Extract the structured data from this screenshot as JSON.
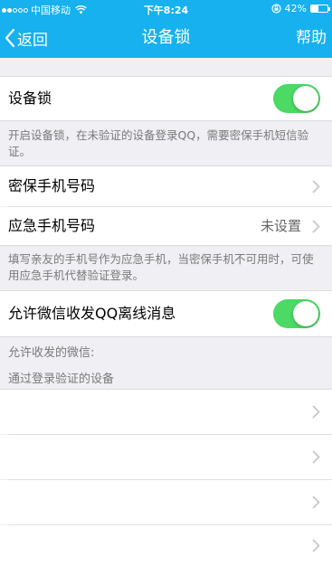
{
  "status_bar": {
    "carrier": "中国移动",
    "time": "下午8:24",
    "battery": "42%",
    "battery_level": 0.42
  },
  "nav": {
    "back_label": "返回",
    "title": "设备锁",
    "help_label": "帮助"
  },
  "device_lock": {
    "label": "设备锁",
    "enabled": true,
    "description": "开启设备锁，在未验证的设备登录QQ，需要密保手机短信验证。"
  },
  "phones": {
    "security_phone_label": "密保手机号码",
    "emergency_phone_label": "应急手机号码",
    "emergency_phone_value": "未设置",
    "description": "填写亲友的手机号作为应急手机，当密保手机不可用时，可使用应急手机代替验证登录。"
  },
  "wechat": {
    "label": "允许微信收发QQ离线消息",
    "enabled": true,
    "allowed_wechat_label": "允许收发的微信:"
  },
  "devices": {
    "section_label": "通过登录验证的设备",
    "items": [
      {
        "name": ""
      },
      {
        "name": ""
      },
      {
        "name": ""
      },
      {
        "name": ""
      }
    ]
  }
}
